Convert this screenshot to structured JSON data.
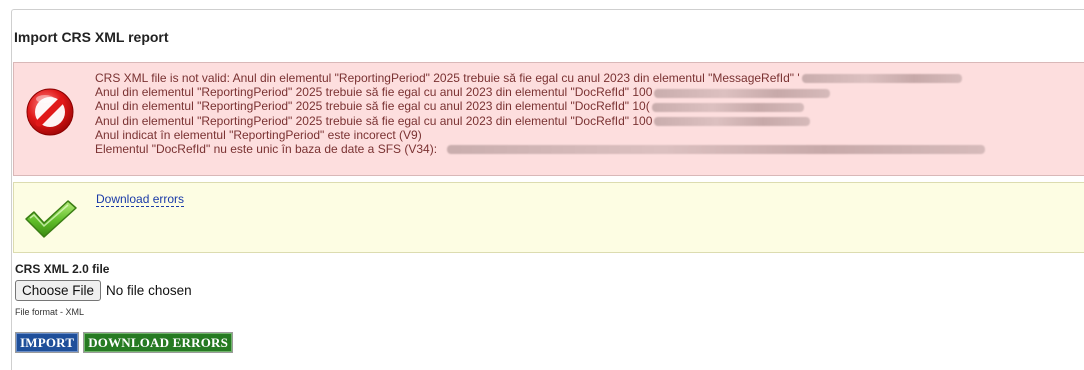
{
  "page": {
    "title": "Import CRS XML report"
  },
  "errors": {
    "icon": "forbidden-icon",
    "color": "#7a3232",
    "background": "#fddede",
    "lines": [
      "CRS XML file is not valid: Anul din elementul \"ReportingPeriod\" 2025 trebuie să fie egal cu anul 2023 din elementul \"MessageRefId\" '",
      "Anul din elementul \"ReportingPeriod\" 2025 trebuie să fie egal cu anul 2023 din elementul \"DocRefId\" 100",
      "Anul din elementul \"ReportingPeriod\" 2025 trebuie să fie egal cu anul 2023 din elementul \"DocRefId\" 10(",
      "Anul din elementul \"ReportingPeriod\" 2025 trebuie să fie egal cu anul 2023 din elementul \"DocRefId\" 100",
      "Anul indicat în elementul \"ReportingPeriod\" este incorect (V9)",
      "Elementul \"DocRefId\" nu este unic în baza de date a SFS (V34):"
    ]
  },
  "success": {
    "icon": "checkmark-icon",
    "background": "#fdfde3",
    "link_label": "Download errors"
  },
  "upload": {
    "label": "CRS XML 2.0 file",
    "choose_button": "Choose File",
    "status": "No file chosen",
    "hint": "File format - XML"
  },
  "actions": {
    "import_label": "IMPORT",
    "download_label": "DOWNLOAD ERRORS",
    "import_color": "#1f4f9a",
    "download_color": "#267a22"
  }
}
